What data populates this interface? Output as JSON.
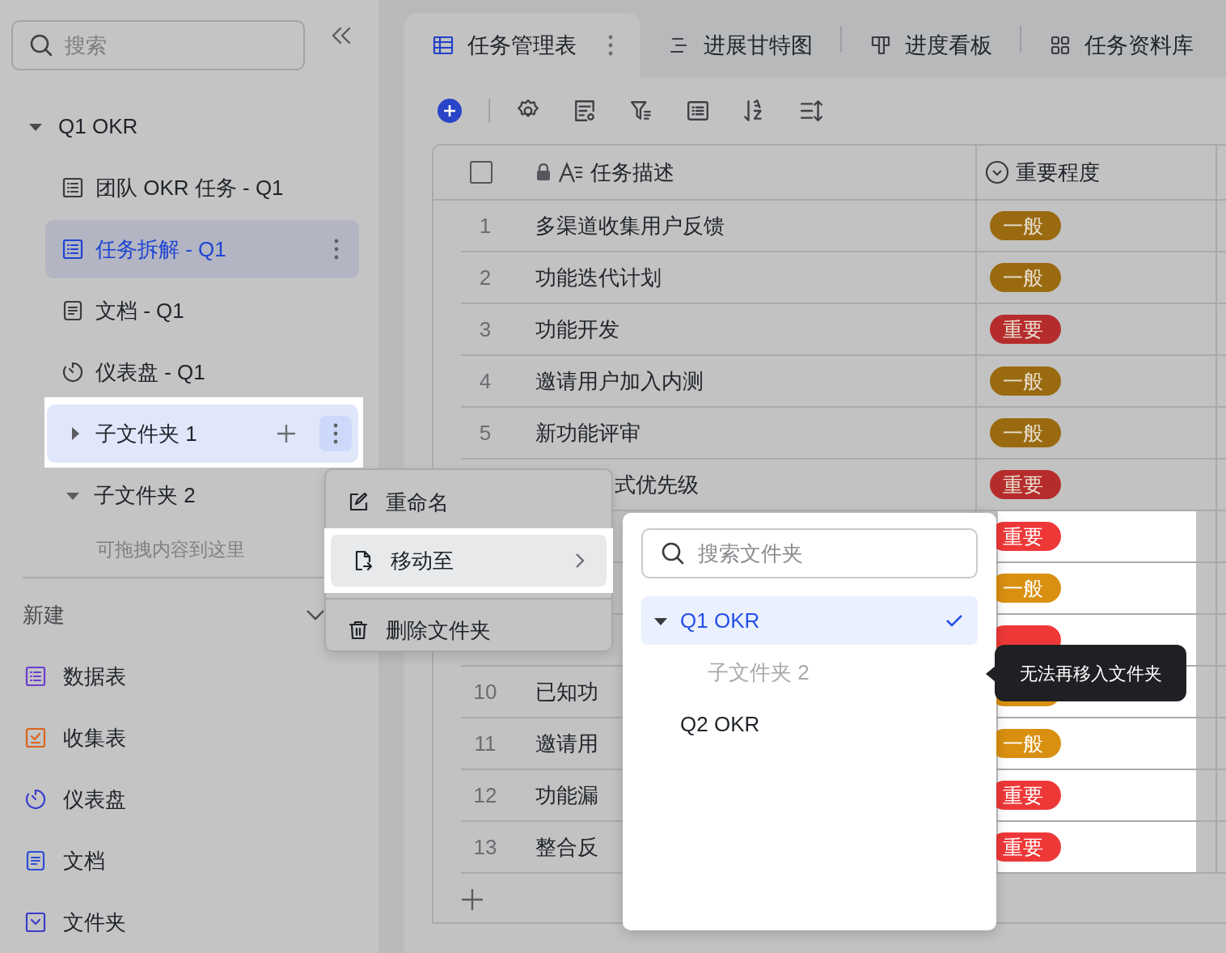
{
  "sidebar": {
    "search": {
      "placeholder": "搜索"
    },
    "tree": [
      {
        "label": "Q1 OKR",
        "kind": "folder",
        "expanded": true,
        "children": [
          {
            "label": "团队 OKR 任务 - Q1",
            "kind": "table",
            "selected": false,
            "highlighted": false
          },
          {
            "label": "任务拆解 - Q1",
            "kind": "table",
            "selected": true,
            "highlighted": false
          },
          {
            "label": "文档 - Q1",
            "kind": "doc",
            "selected": false,
            "highlighted": false
          },
          {
            "label": "仪表盘 - Q1",
            "kind": "dashboard",
            "selected": false,
            "highlighted": false
          },
          {
            "label": "子文件夹 1",
            "kind": "folder",
            "expanded": false,
            "selected": false,
            "highlighted": true
          },
          {
            "label": "子文件夹 2",
            "kind": "folder",
            "expanded": true,
            "selected": false,
            "highlighted": false,
            "empty_hint": "可拖拽内容到这里"
          }
        ]
      }
    ],
    "new_section": {
      "title": "新建",
      "items": [
        {
          "label": "数据表",
          "kind": "table",
          "color": "#6b3ccf"
        },
        {
          "label": "收集表",
          "kind": "form",
          "color": "#d9631c"
        },
        {
          "label": "仪表盘",
          "kind": "dashboard",
          "color": "#3a3dcc"
        },
        {
          "label": "文档",
          "kind": "doc",
          "color": "#2c4fd4"
        },
        {
          "label": "文件夹",
          "kind": "folder",
          "color": "#3a3dc8"
        }
      ]
    }
  },
  "tabs": [
    {
      "label": "任务管理表",
      "kind": "grid",
      "selected": true
    },
    {
      "label": "进展甘特图",
      "kind": "gantt",
      "selected": false
    },
    {
      "label": "进度看板",
      "kind": "kanban",
      "selected": false
    },
    {
      "label": "任务资料库",
      "kind": "gallery",
      "selected": false
    }
  ],
  "table": {
    "select_all": {
      "checked": false
    },
    "columns": [
      {
        "label": "任务描述",
        "kind": "text",
        "locked": true
      },
      {
        "label": "重要程度",
        "kind": "select",
        "locked": false
      }
    ],
    "rows": [
      {
        "number": "1",
        "description": "多渠道收集用户反馈",
        "importance": {
          "label": "一般",
          "kind": "normal"
        },
        "highlighted": false
      },
      {
        "number": "2",
        "description": "功能迭代计划",
        "importance": {
          "label": "一般",
          "kind": "normal"
        },
        "highlighted": false
      },
      {
        "number": "3",
        "description": "功能开发",
        "importance": {
          "label": "重要",
          "kind": "important"
        },
        "highlighted": false
      },
      {
        "number": "4",
        "description": "邀请用户加入内测",
        "importance": {
          "label": "一般",
          "kind": "normal"
        },
        "highlighted": false
      },
      {
        "number": "5",
        "description": "新功能评审",
        "importance": {
          "label": "一般",
          "kind": "normal"
        },
        "highlighted": false
      },
      {
        "description": "式优先级",
        "importance": {
          "label": "重要",
          "kind": "important"
        },
        "highlighted": false
      },
      {
        "importance": {
          "label": "重要",
          "kind": "important"
        },
        "highlighted": true
      },
      {
        "importance": {
          "label": "一般",
          "kind": "normal"
        },
        "highlighted": true
      },
      {
        "importance": {
          "kind": "important"
        },
        "highlighted": true
      },
      {
        "number": "10",
        "description": "已知功",
        "importance": {
          "kind": "normal"
        },
        "highlighted": true
      },
      {
        "number": "11",
        "description": "邀请用",
        "importance": {
          "label": "一般",
          "kind": "normal"
        },
        "highlighted": true
      },
      {
        "number": "12",
        "description": "功能漏",
        "importance": {
          "label": "重要",
          "kind": "important"
        },
        "highlighted": true
      },
      {
        "number": "13",
        "description": "整合反",
        "importance": {
          "label": "重要",
          "kind": "important"
        },
        "highlighted": true
      }
    ]
  },
  "context_menu": {
    "items": [
      {
        "label": "重命名",
        "kind": "rename",
        "highlighted": false,
        "divider_before": false,
        "submenu": false
      },
      {
        "label": "移动至",
        "kind": "move",
        "highlighted": true,
        "divider_before": false,
        "submenu": true
      },
      {
        "label": "删除文件夹",
        "kind": "delete",
        "highlighted": false,
        "divider_before": true,
        "submenu": false
      }
    ]
  },
  "move_popup": {
    "search": {
      "placeholder": "搜索文件夹"
    },
    "folders": [
      {
        "label": "Q1 OKR",
        "expanded": true,
        "selected": true,
        "disabled": false,
        "children": [
          {
            "label": "子文件夹 2",
            "selected": false,
            "disabled": true
          }
        ]
      },
      {
        "label": "Q2 OKR",
        "selected": false,
        "disabled": false
      }
    ],
    "tooltip": "无法再移入文件夹"
  }
}
